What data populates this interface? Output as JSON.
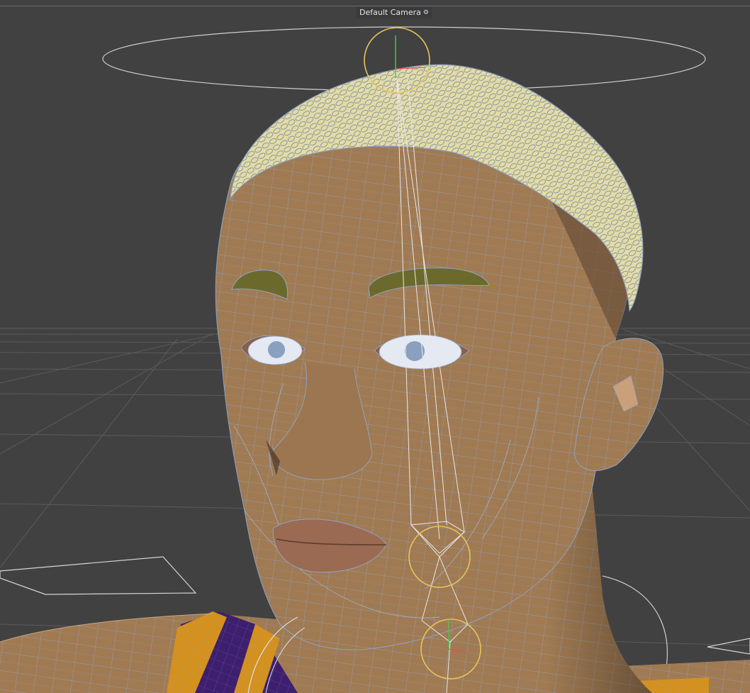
{
  "viewport": {
    "camera_label": "Default Camera",
    "camera_icon": "camera-options-icon",
    "colors": {
      "background": "#414141",
      "grid": "#5a5a5a",
      "skin": "#a07a52",
      "wire": "#8fa3c4",
      "hair": "#e3dca4",
      "eyebrow": "#6b6a2c",
      "lips": "#9a6a52",
      "shirt_purple": "#3d1f6e",
      "shirt_orange": "#d4911e",
      "joint_yellow": "#e6c45a",
      "guide_white": "#d8d8d8"
    }
  }
}
